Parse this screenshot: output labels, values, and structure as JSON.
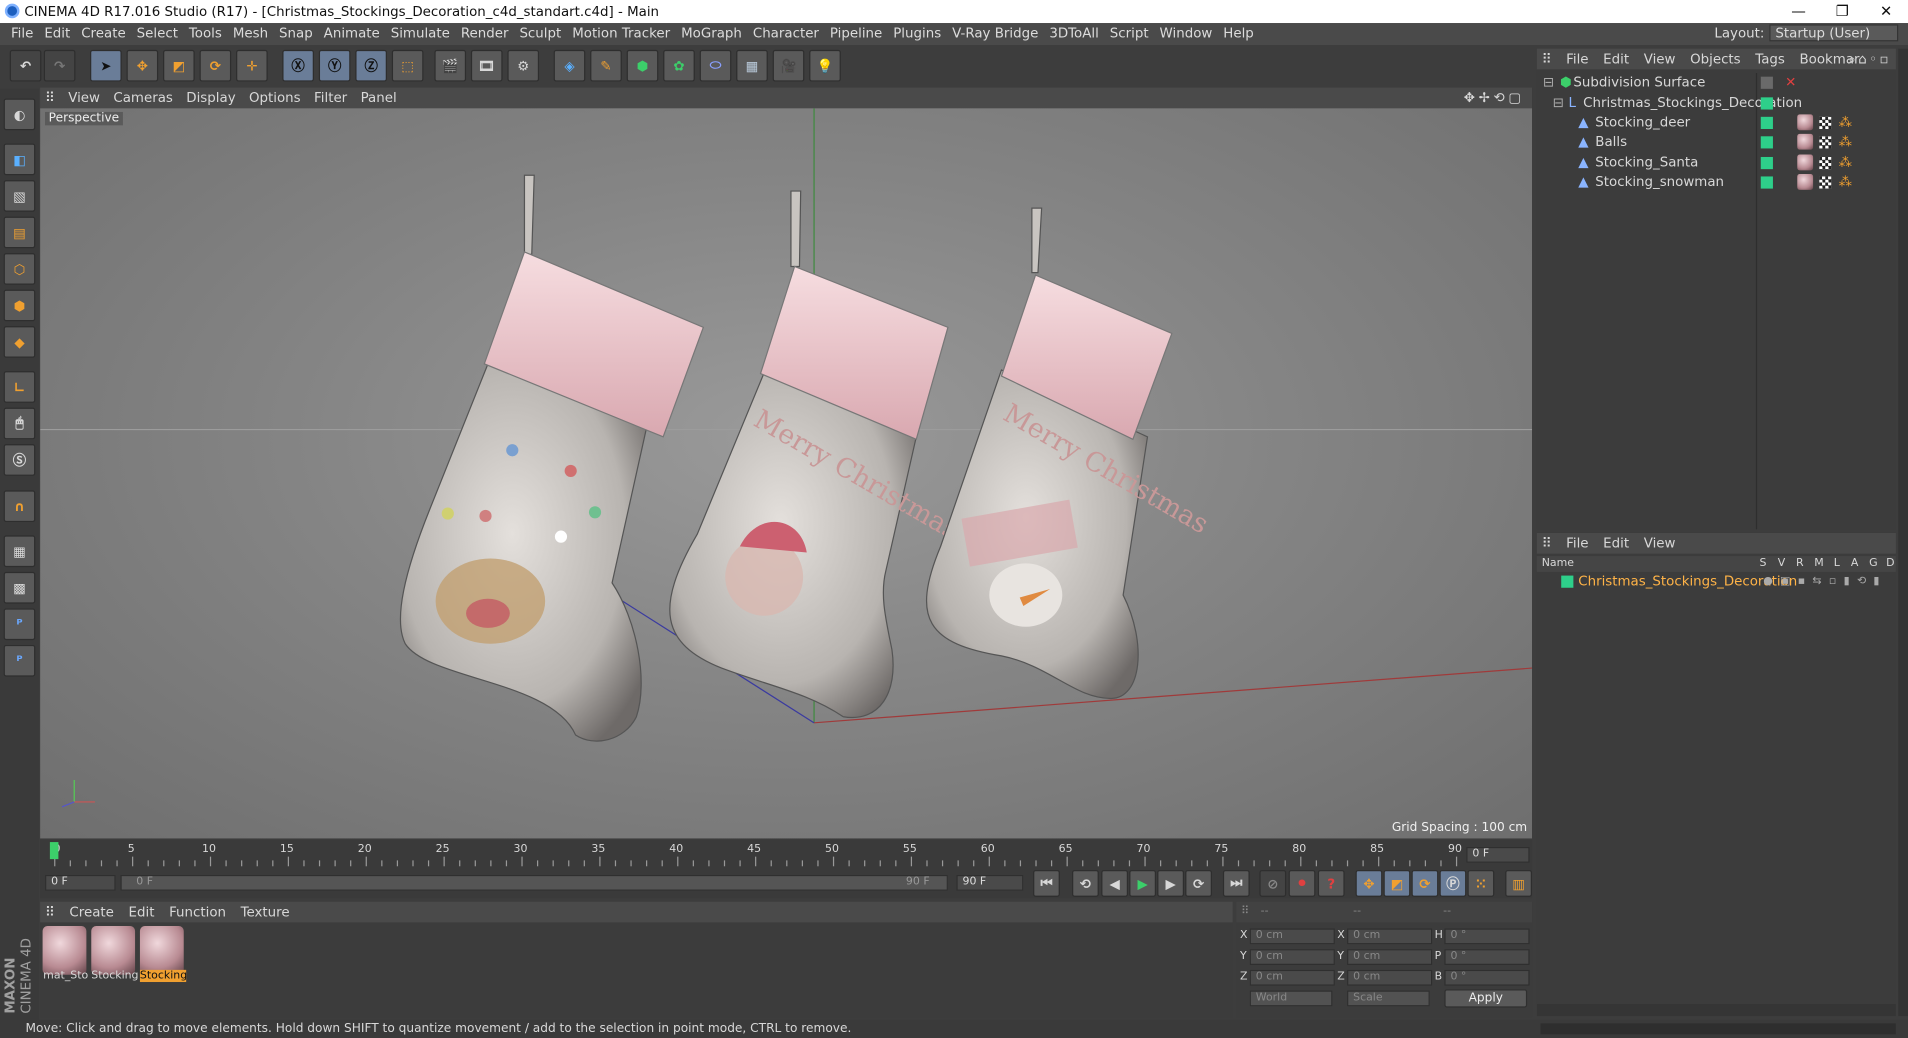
{
  "window": {
    "title": "CINEMA 4D R17.016 Studio (R17) - [Christmas_Stockings_Decoration_c4d_standart.c4d] - Main"
  },
  "menu": [
    "File",
    "Edit",
    "Create",
    "Select",
    "Tools",
    "Mesh",
    "Snap",
    "Animate",
    "Simulate",
    "Render",
    "Sculpt",
    "Motion Tracker",
    "MoGraph",
    "Character",
    "Pipeline",
    "Plugins",
    "V-Ray Bridge",
    "3DToAll",
    "Script",
    "Window",
    "Help"
  ],
  "layout": {
    "label": "Layout:",
    "value": "Startup (User)"
  },
  "viewport": {
    "menu": [
      "View",
      "Cameras",
      "Display",
      "Options",
      "Filter",
      "Panel"
    ],
    "label": "Perspective",
    "grid_spacing": "Grid Spacing : 100 cm",
    "stocking_texts": [
      "Merry Christmas",
      "Merry Christmas"
    ]
  },
  "objects": {
    "menu": [
      "File",
      "Edit",
      "View",
      "Objects",
      "Tags",
      "Bookmar"
    ],
    "items": [
      {
        "name": "Subdivision Surface",
        "level": 0
      },
      {
        "name": "Christmas_Stockings_Decoration",
        "level": 1
      },
      {
        "name": "Stocking_deer",
        "level": 2
      },
      {
        "name": "Balls",
        "level": 2
      },
      {
        "name": "Stocking_Santa",
        "level": 2
      },
      {
        "name": "Stocking_snowman",
        "level": 2
      }
    ]
  },
  "layers": {
    "menu": [
      "File",
      "Edit",
      "View"
    ],
    "columns": [
      "Name",
      "S",
      "V",
      "R",
      "M",
      "L",
      "A",
      "G",
      "D"
    ],
    "item": "Christmas_Stockings_Decoration"
  },
  "timeline": {
    "ticks": [
      "0",
      "5",
      "10",
      "15",
      "20",
      "25",
      "30",
      "35",
      "40",
      "45",
      "50",
      "55",
      "60",
      "65",
      "70",
      "75",
      "80",
      "85",
      "90"
    ],
    "current": "0 F",
    "start": "0 F",
    "range_start": "0 F",
    "range_end": "90 F",
    "end": "90 F"
  },
  "materials": {
    "menu": [
      "Create",
      "Edit",
      "Function",
      "Texture"
    ],
    "items": [
      "mat_Sto",
      "Stocking",
      "Stocking"
    ]
  },
  "coords": {
    "headers": [
      "--",
      "--",
      "--"
    ],
    "rows": [
      {
        "a": "X",
        "av": "0 cm",
        "b": "X",
        "bv": "0 cm",
        "c": "H",
        "cv": "0 °"
      },
      {
        "a": "Y",
        "av": "0 cm",
        "b": "Y",
        "bv": "0 cm",
        "c": "P",
        "cv": "0 °"
      },
      {
        "a": "Z",
        "av": "0 cm",
        "b": "Z",
        "bv": "0 cm",
        "c": "B",
        "cv": "0 °"
      }
    ],
    "world": "World",
    "scale": "Scale",
    "apply": "Apply"
  },
  "brand": {
    "maxon": "MAXON",
    "product": "CINEMA 4D"
  },
  "status": "Move: Click and drag to move elements. Hold down SHIFT to quantize movement / add to the selection in point mode, CTRL to remove.",
  "colors": {
    "accent": "#f0a030",
    "selection": "#ffb347",
    "tag_green": "#2ecf8a"
  }
}
